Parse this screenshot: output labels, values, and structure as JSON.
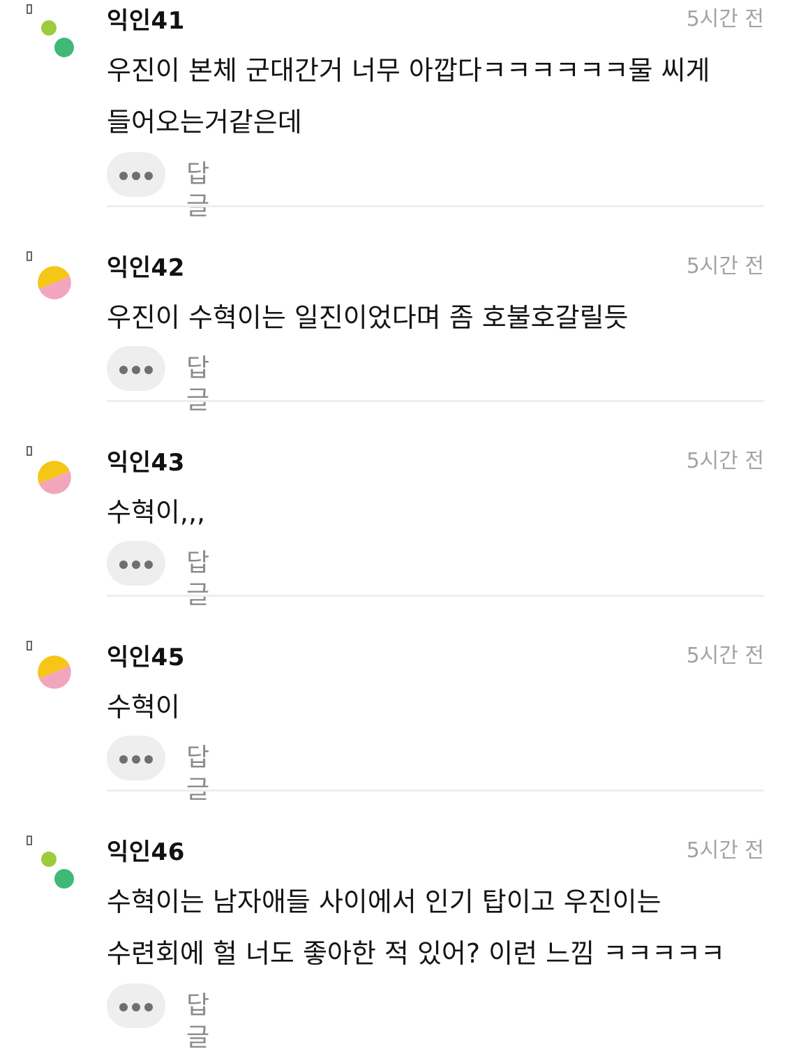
{
  "comments": [
    {
      "author": "익인41",
      "time": "5시간 전",
      "text": "우진이 본체 군대간거 너무 아깝다ㅋㅋㅋㅋㅋㅋ물 씨게 들어오는거같은데",
      "reply_label": "답글",
      "avatar": "green-dots"
    },
    {
      "author": "익인42",
      "time": "5시간 전",
      "text": "우진이 수혁이는 일진이었다며 좀 호불호갈릴듯",
      "reply_label": "답글",
      "avatar": "yellow-pink"
    },
    {
      "author": "익인43",
      "time": "5시간 전",
      "text": "수혁이,,,",
      "reply_label": "답글",
      "avatar": "yellow-pink"
    },
    {
      "author": "익인45",
      "time": "5시간 전",
      "text": "수혁이",
      "reply_label": "답글",
      "avatar": "yellow-pink"
    },
    {
      "author": "익인46",
      "time": "5시간 전",
      "text": "수혁이는 남자애들 사이에서 인기 탑이고 우진이는 수련회에 헐 너도 좋아한 적 있어? 이런 느낌 ㅋㅋㅋㅋㅋ",
      "reply_label": "답글",
      "avatar": "green-dots"
    }
  ],
  "icons": {
    "more": "more-dots-icon",
    "reply_marker": "reply-marker-icon"
  },
  "colors": {
    "author": "#111111",
    "timestamp": "#a3a3a3",
    "reply_label": "#8b8b8b",
    "more_button_bg": "#eeeeee",
    "divider": "#eeeeee",
    "avatar_light_green": "#9ccc3d",
    "avatar_green": "#3fb878",
    "avatar_yellow": "#f5c518",
    "avatar_pink": "#f2a6bd"
  }
}
